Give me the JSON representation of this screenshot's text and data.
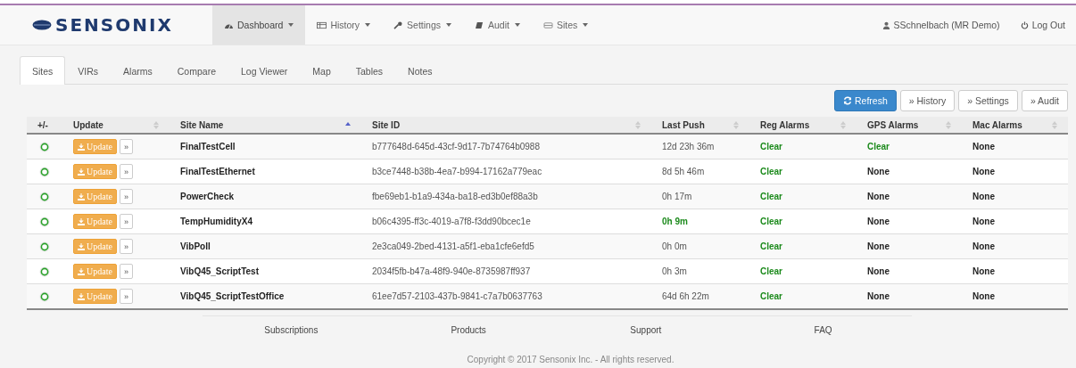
{
  "navbar": {
    "brand": "SENSONIX",
    "menu": [
      {
        "label": "Dashboard",
        "selected": true
      },
      {
        "label": "History",
        "selected": false
      },
      {
        "label": "Settings",
        "selected": false
      },
      {
        "label": "Audit",
        "selected": false
      },
      {
        "label": "Sites",
        "selected": false
      }
    ],
    "user": "SSchnelbach (MR Demo)",
    "logout": "Log Out"
  },
  "tabs": [
    {
      "label": "Sites",
      "selected": true
    },
    {
      "label": "VIRs",
      "selected": false
    },
    {
      "label": "Alarms",
      "selected": false
    },
    {
      "label": "Compare",
      "selected": false
    },
    {
      "label": "Log Viewer",
      "selected": false
    },
    {
      "label": "Map",
      "selected": false
    },
    {
      "label": "Tables",
      "selected": false
    },
    {
      "label": "Notes",
      "selected": false
    }
  ],
  "actions": [
    {
      "label": "Refresh",
      "kind": "primary"
    },
    {
      "label": "» History",
      "kind": "default"
    },
    {
      "label": "» Settings",
      "kind": "default"
    },
    {
      "label": "» Audit",
      "kind": "default"
    }
  ],
  "table": {
    "columns": [
      {
        "label": "+/-",
        "sortable": false,
        "sorted": false
      },
      {
        "label": "Update",
        "sortable": true,
        "sorted": false
      },
      {
        "label": "Site Name",
        "sortable": true,
        "sorted": true
      },
      {
        "label": "Site ID",
        "sortable": true,
        "sorted": false
      },
      {
        "label": "Last Push",
        "sortable": true,
        "sorted": false
      },
      {
        "label": "Reg Alarms",
        "sortable": true,
        "sorted": false
      },
      {
        "label": "GPS Alarms",
        "sortable": true,
        "sorted": false
      },
      {
        "label": "Mac Alarms",
        "sortable": true,
        "sorted": false
      }
    ],
    "rows": [
      {
        "update": "Update",
        "more": "»",
        "name": "FinalTestCell",
        "id": "b777648d-645d-43cf-9d17-7b74764b0988",
        "last_push": "12d 23h 36m",
        "recent": false,
        "reg": {
          "text": "Clear",
          "ok": true
        },
        "gps": {
          "text": "Clear",
          "ok": true
        },
        "mac": {
          "text": "None",
          "ok": false
        }
      },
      {
        "update": "Update",
        "more": "»",
        "name": "FinalTestEthernet",
        "id": "b3ce7448-b38b-4ea7-b994-17162a779eac",
        "last_push": "8d 5h 46m",
        "recent": false,
        "reg": {
          "text": "Clear",
          "ok": true
        },
        "gps": {
          "text": "None",
          "ok": false
        },
        "mac": {
          "text": "None",
          "ok": false
        }
      },
      {
        "update": "Update",
        "more": "»",
        "name": "PowerCheck",
        "id": "fbe69eb1-b1a9-434a-ba18-ed3b0ef88a3b",
        "last_push": "0h 17m",
        "recent": false,
        "reg": {
          "text": "Clear",
          "ok": true
        },
        "gps": {
          "text": "None",
          "ok": false
        },
        "mac": {
          "text": "None",
          "ok": false
        }
      },
      {
        "update": "Update",
        "more": "»",
        "name": "TempHumidityX4",
        "id": "b06c4395-ff3c-4019-a7f8-f3dd90bcec1e",
        "last_push": "0h 9m",
        "recent": true,
        "reg": {
          "text": "Clear",
          "ok": true
        },
        "gps": {
          "text": "None",
          "ok": false
        },
        "mac": {
          "text": "None",
          "ok": false
        }
      },
      {
        "update": "Update",
        "more": "»",
        "name": "VibPoll",
        "id": "2e3ca049-2bed-4131-a5f1-eba1cfe6efd5",
        "last_push": "0h 0m",
        "recent": false,
        "reg": {
          "text": "Clear",
          "ok": true
        },
        "gps": {
          "text": "None",
          "ok": false
        },
        "mac": {
          "text": "None",
          "ok": false
        }
      },
      {
        "update": "Update",
        "more": "»",
        "name": "VibQ45_ScriptTest",
        "id": "2034f5fb-b47a-48f9-940e-8735987ff937",
        "last_push": "0h 3m",
        "recent": false,
        "reg": {
          "text": "Clear",
          "ok": true
        },
        "gps": {
          "text": "None",
          "ok": false
        },
        "mac": {
          "text": "None",
          "ok": false
        }
      },
      {
        "update": "Update",
        "more": "»",
        "name": "VibQ45_ScriptTestOffice",
        "id": "61ee7d57-2103-437b-9841-c7a7b0637763",
        "last_push": "64d 6h 22m",
        "recent": false,
        "reg": {
          "text": "Clear",
          "ok": true
        },
        "gps": {
          "text": "None",
          "ok": false
        },
        "mac": {
          "text": "None",
          "ok": false
        }
      }
    ]
  },
  "footer": {
    "links": [
      "Subscriptions",
      "Products",
      "Support",
      "FAQ"
    ],
    "copyright": "Copyright © 2017 Sensonix Inc. - All rights reserved."
  }
}
